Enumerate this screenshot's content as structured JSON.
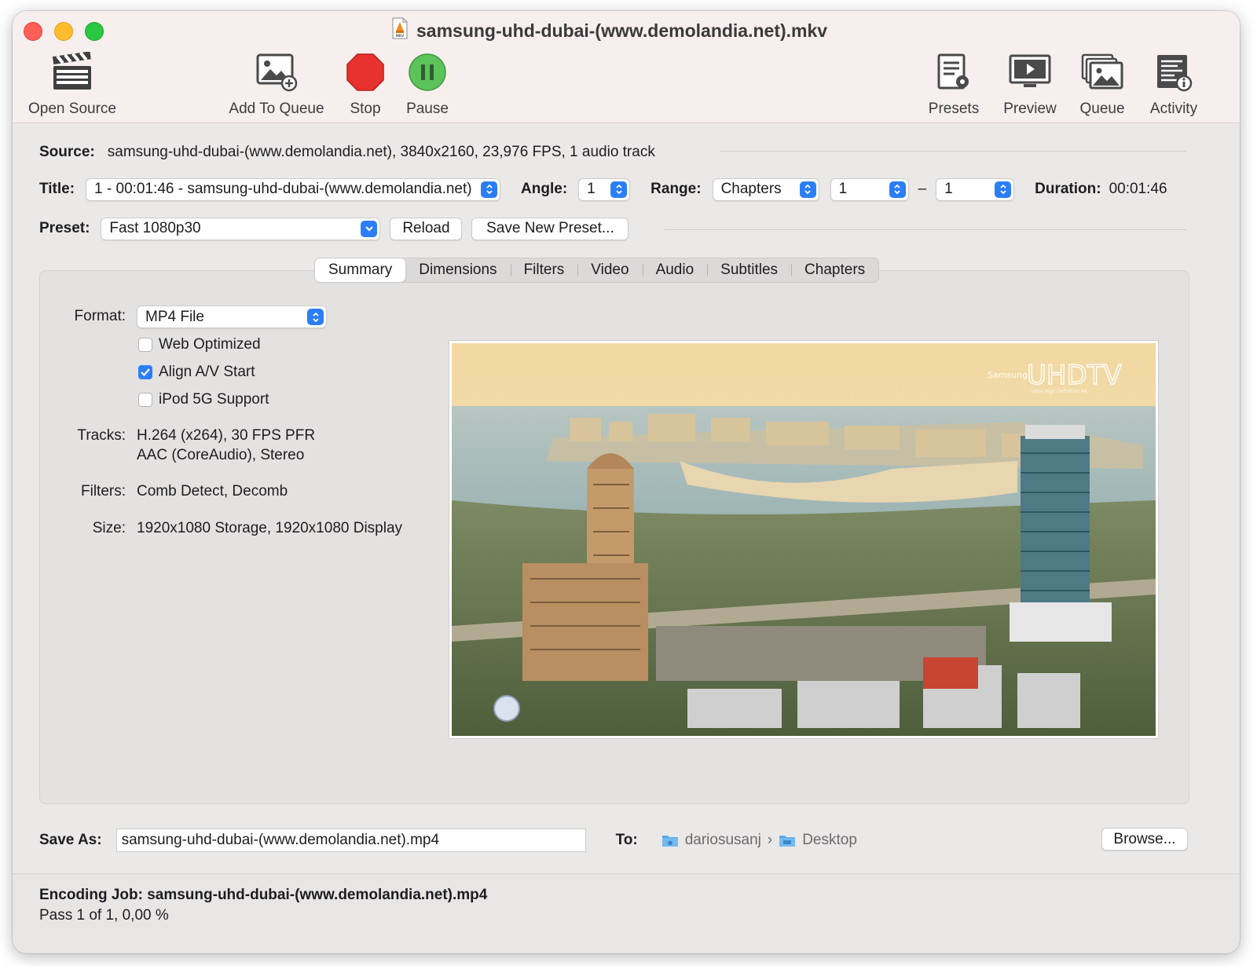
{
  "window": {
    "title": "samsung-uhd-dubai-(www.demolandia.net).mkv",
    "file_badge": "MKV"
  },
  "toolbar": {
    "open_source": "Open Source",
    "add_to_queue": "Add To Queue",
    "stop": "Stop",
    "pause": "Pause",
    "presets": "Presets",
    "preview": "Preview",
    "queue": "Queue",
    "activity": "Activity"
  },
  "source": {
    "label": "Source:",
    "value": "samsung-uhd-dubai-(www.demolandia.net), 3840x2160, 23,976 FPS, 1 audio track"
  },
  "title_row": {
    "title_label": "Title:",
    "title_value": "1 - 00:01:46 - samsung-uhd-dubai-(www.demolandia.net)",
    "angle_label": "Angle:",
    "angle_value": "1",
    "range_label": "Range:",
    "range_type": "Chapters",
    "range_start": "1",
    "range_sep": "–",
    "range_end": "1",
    "duration_label": "Duration:",
    "duration_value": "00:01:46"
  },
  "preset_row": {
    "label": "Preset:",
    "value": "Fast 1080p30",
    "reload": "Reload",
    "save_new": "Save New Preset..."
  },
  "tabs": [
    "Summary",
    "Dimensions",
    "Filters",
    "Video",
    "Audio",
    "Subtitles",
    "Chapters"
  ],
  "summary": {
    "format_label": "Format:",
    "format_value": "MP4 File",
    "web_optimized": "Web Optimized",
    "align_av": "Align A/V Start",
    "ipod": "iPod 5G Support",
    "tracks_label": "Tracks:",
    "tracks_line1": "H.264 (x264), 30 FPS PFR",
    "tracks_line2": "AAC (CoreAudio), Stereo",
    "filters_label": "Filters:",
    "filters_value": "Comb Detect, Decomb",
    "size_label": "Size:",
    "size_value": "1920x1080 Storage, 1920x1080 Display"
  },
  "preview_image": {
    "brand_small": "Samsung",
    "brand_big": "UHDTV",
    "brand_sub": "Ultra High Definition 4K"
  },
  "save": {
    "label": "Save As:",
    "value": "samsung-uhd-dubai-(www.demolandia.net).mp4",
    "to_label": "To:",
    "path_user": "dariosusanj",
    "path_sep": "›",
    "path_folder": "Desktop",
    "browse": "Browse..."
  },
  "status": {
    "job": "Encoding Job: samsung-uhd-dubai-(www.demolandia.net).mp4",
    "progress": "Pass 1 of 1, 0,00 %"
  },
  "colors": {
    "accent": "#2b7ef7",
    "stop": "#e8322f",
    "pause": "#5cc35a",
    "close": "#fe5f57",
    "minimize": "#febc2e",
    "zoom": "#28c840"
  }
}
